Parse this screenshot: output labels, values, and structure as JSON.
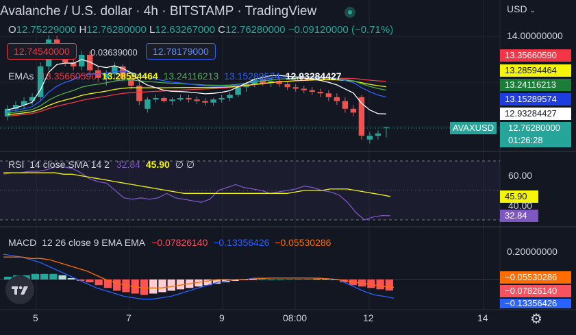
{
  "header": {
    "title": "Avalanche / U.S. dollar · 4h · BITSTAMP · TradingView",
    "currency": "USD",
    "ohlc": {
      "o_label": "O",
      "o": "12.75229000",
      "h_label": "H",
      "h": "12.76280000",
      "l_label": "L",
      "l": "12.63267000",
      "c_label": "C",
      "c": "12.76280000",
      "change": "−0.09120000 (−0.71%)"
    },
    "sell_price": "12.74540000",
    "spread": "0.03639000",
    "buy_price": "12.78179000"
  },
  "emas": {
    "label": "EMAs",
    "values": [
      "13.35660590",
      "13.28594464",
      "13.24116213",
      "13.15289574",
      "12.93284427"
    ],
    "colors": [
      "#f23645",
      "#f5f50a",
      "#4caf50",
      "#2962ff",
      "#ffffff"
    ]
  },
  "price_axis": {
    "ticks": [
      "14.00000000"
    ],
    "labels": [
      {
        "text": "13.35660590",
        "bg": "#f23645",
        "fg": "#ffffff"
      },
      {
        "text": "13.28594464",
        "bg": "#f5f50a",
        "fg": "#131722"
      },
      {
        "text": "13.24116213",
        "bg": "#1b7d37",
        "fg": "#ffffff"
      },
      {
        "text": "13.15289574",
        "bg": "#1e3de0",
        "fg": "#ffffff"
      },
      {
        "text": "12.93284427",
        "bg": "#ffffff",
        "fg": "#131722"
      }
    ],
    "symbol": "AVAXUSD",
    "last_price": "12.76280000",
    "countdown": "01:26:28"
  },
  "rsi": {
    "label": "RSI",
    "params": "14 close SMA 14 2",
    "value": "32.84",
    "sma": "45.90",
    "extra": "∅ ∅",
    "ticks": [
      "60.00",
      "40.00"
    ],
    "upper": 70,
    "lower": 30
  },
  "macd": {
    "label": "MACD",
    "params": "12 26 close 9 EMA EMA",
    "histogram": "−0.07826140",
    "macd": "−0.13356426",
    "signal": "−0.05530286",
    "ticks": [
      "0.20000000"
    ],
    "axis_labels": [
      "−0.05530286",
      "−0.07826140",
      "−0.13356426"
    ]
  },
  "time_axis": [
    "5",
    "7",
    "9",
    "08:00",
    "12",
    "14"
  ],
  "colors": {
    "up": "#26a69a",
    "down": "#ef5350",
    "bg": "#131722",
    "grid": "#2a2e39",
    "text": "#d1d4dc"
  },
  "chart_data": [
    {
      "type": "candlestick",
      "title": "Avalanche / U.S. dollar · 4h · BITSTAMP",
      "x": [
        "5",
        "7",
        "9",
        "08:00",
        "12",
        "14"
      ],
      "candles": [
        {
          "o": 12.9,
          "h": 13.05,
          "l": 12.85,
          "c": 13.0
        },
        {
          "o": 13.0,
          "h": 13.1,
          "l": 12.95,
          "c": 13.05
        },
        {
          "o": 13.05,
          "h": 13.15,
          "l": 13.0,
          "c": 13.1
        },
        {
          "o": 13.1,
          "h": 13.2,
          "l": 13.05,
          "c": 13.15
        },
        {
          "o": 13.15,
          "h": 13.6,
          "l": 13.1,
          "c": 13.55
        },
        {
          "o": 13.55,
          "h": 13.95,
          "l": 13.5,
          "c": 13.9
        },
        {
          "o": 13.9,
          "h": 13.95,
          "l": 13.7,
          "c": 13.75
        },
        {
          "o": 13.75,
          "h": 13.8,
          "l": 13.55,
          "c": 13.6
        },
        {
          "o": 13.6,
          "h": 13.7,
          "l": 13.5,
          "c": 13.55
        },
        {
          "o": 13.55,
          "h": 13.75,
          "l": 13.5,
          "c": 13.7
        },
        {
          "o": 13.7,
          "h": 13.75,
          "l": 13.45,
          "c": 13.5
        },
        {
          "o": 13.5,
          "h": 13.55,
          "l": 13.35,
          "c": 13.4
        },
        {
          "o": 13.4,
          "h": 13.5,
          "l": 13.3,
          "c": 13.45
        },
        {
          "o": 13.45,
          "h": 13.6,
          "l": 13.4,
          "c": 13.55
        },
        {
          "o": 13.55,
          "h": 13.58,
          "l": 13.35,
          "c": 13.4
        },
        {
          "o": 13.4,
          "h": 13.45,
          "l": 13.25,
          "c": 13.3
        },
        {
          "o": 13.3,
          "h": 13.35,
          "l": 13.05,
          "c": 13.1
        },
        {
          "o": 13.0,
          "h": 13.15,
          "l": 12.95,
          "c": 13.12
        },
        {
          "o": 13.12,
          "h": 13.18,
          "l": 13.08,
          "c": 13.14
        },
        {
          "o": 13.14,
          "h": 13.16,
          "l": 13.08,
          "c": 13.1
        },
        {
          "o": 13.1,
          "h": 13.15,
          "l": 13.05,
          "c": 13.12
        },
        {
          "o": 13.12,
          "h": 13.18,
          "l": 13.1,
          "c": 13.14
        },
        {
          "o": 13.14,
          "h": 13.18,
          "l": 13.08,
          "c": 13.12
        },
        {
          "o": 13.12,
          "h": 13.16,
          "l": 13.06,
          "c": 13.1
        },
        {
          "o": 13.1,
          "h": 13.14,
          "l": 13.04,
          "c": 13.08
        },
        {
          "o": 13.08,
          "h": 13.14,
          "l": 13.04,
          "c": 13.12
        },
        {
          "o": 13.12,
          "h": 13.18,
          "l": 13.08,
          "c": 13.14
        },
        {
          "o": 13.14,
          "h": 13.22,
          "l": 13.1,
          "c": 13.18
        },
        {
          "o": 13.18,
          "h": 13.3,
          "l": 13.15,
          "c": 13.28
        },
        {
          "o": 13.28,
          "h": 13.35,
          "l": 13.22,
          "c": 13.32
        },
        {
          "o": 13.32,
          "h": 13.42,
          "l": 13.28,
          "c": 13.38
        },
        {
          "o": 13.38,
          "h": 13.45,
          "l": 13.3,
          "c": 13.33
        },
        {
          "o": 13.33,
          "h": 13.4,
          "l": 13.28,
          "c": 13.36
        },
        {
          "o": 13.36,
          "h": 13.4,
          "l": 13.28,
          "c": 13.32
        },
        {
          "o": 13.32,
          "h": 13.36,
          "l": 13.24,
          "c": 13.28
        },
        {
          "o": 13.28,
          "h": 13.32,
          "l": 13.22,
          "c": 13.26
        },
        {
          "o": 13.26,
          "h": 13.3,
          "l": 13.2,
          "c": 13.24
        },
        {
          "o": 13.24,
          "h": 13.28,
          "l": 13.18,
          "c": 13.22
        },
        {
          "o": 13.22,
          "h": 13.26,
          "l": 13.15,
          "c": 13.2
        },
        {
          "o": 13.2,
          "h": 13.24,
          "l": 13.1,
          "c": 13.15
        },
        {
          "o": 13.15,
          "h": 13.2,
          "l": 13.05,
          "c": 13.1
        },
        {
          "o": 13.1,
          "h": 13.15,
          "l": 12.95,
          "c": 13.0
        },
        {
          "o": 13.0,
          "h": 13.05,
          "l": 12.9,
          "c": 12.95
        },
        {
          "o": 13.15,
          "h": 13.18,
          "l": 12.6,
          "c": 12.65
        },
        {
          "o": 12.6,
          "h": 12.7,
          "l": 12.55,
          "c": 12.65
        },
        {
          "o": 12.65,
          "h": 12.72,
          "l": 12.6,
          "c": 12.68
        },
        {
          "o": 12.75,
          "h": 12.76,
          "l": 12.63,
          "c": 12.76
        }
      ],
      "ema_series": [
        {
          "value": 13.3566059,
          "color": "#f23645"
        },
        {
          "value": 13.28594464,
          "color": "#f5f50a"
        },
        {
          "value": 13.24116213,
          "color": "#4caf50"
        },
        {
          "value": 13.15289574,
          "color": "#2962ff"
        },
        {
          "value": 12.93284427,
          "color": "#ffffff"
        }
      ]
    },
    {
      "type": "line",
      "title": "RSI 14 close SMA 14 2",
      "ylim": [
        20,
        80
      ],
      "series": [
        {
          "name": "RSI",
          "values": [
            61,
            62,
            62,
            63,
            63,
            64,
            66,
            66,
            65,
            62,
            58,
            56,
            55,
            50,
            45,
            44,
            45,
            44,
            45,
            48,
            45,
            44,
            43,
            42,
            44,
            50,
            52,
            54,
            52,
            51,
            50,
            48,
            49,
            50,
            51,
            53,
            52,
            50,
            49,
            47,
            42,
            35,
            30,
            32,
            33,
            32.84
          ]
        },
        {
          "name": "SMA",
          "values": [
            62,
            62,
            62,
            62,
            62,
            62,
            62,
            61,
            61,
            60,
            59,
            58,
            57,
            56,
            55,
            54,
            53,
            52,
            51,
            50,
            49,
            48,
            48,
            48,
            48,
            48,
            48,
            48,
            48,
            48,
            48,
            48,
            48,
            48,
            49,
            50,
            50,
            50,
            51,
            51,
            51,
            50,
            49,
            48,
            47,
            45.9
          ]
        }
      ]
    },
    {
      "type": "bar",
      "title": "MACD 12 26 close 9 EMA EMA",
      "histogram": [
        0.02,
        0.03,
        0.03,
        0.04,
        0.04,
        0.04,
        0.03,
        0.01,
        -0.01,
        -0.02,
        -0.04,
        -0.06,
        -0.08,
        -0.09,
        -0.1,
        -0.11,
        -0.1,
        -0.09,
        -0.08,
        -0.07,
        -0.06,
        -0.05,
        -0.04,
        -0.03,
        -0.02,
        -0.01,
        -0.005,
        -0.002,
        0.0,
        0.0,
        0.0,
        0.002,
        0.004,
        0.005,
        0.004,
        0.003,
        0.001,
        -0.02,
        -0.04,
        -0.05,
        -0.06,
        -0.07,
        -0.0782614
      ],
      "series": [
        {
          "name": "MACD",
          "values": [
            0.18,
            0.17,
            0.16,
            0.14,
            0.12,
            0.09,
            0.06,
            0.03,
            0.0,
            -0.03,
            -0.06,
            -0.08,
            -0.1,
            -0.12,
            -0.13,
            -0.14,
            -0.14,
            -0.13,
            -0.12,
            -0.1,
            -0.08,
            -0.06,
            -0.04,
            -0.02,
            -0.01,
            0.0,
            0.0,
            0.01,
            0.01,
            0.01,
            0.01,
            0.01,
            0.01,
            0.01,
            0.01,
            0.005,
            0.0,
            -0.03,
            -0.06,
            -0.09,
            -0.11,
            -0.12,
            -0.13356426
          ]
        },
        {
          "name": "Signal",
          "values": [
            0.16,
            0.16,
            0.16,
            0.15,
            0.15,
            0.14,
            0.12,
            0.1,
            0.08,
            0.06,
            0.03,
            0.0,
            -0.02,
            -0.04,
            -0.05,
            -0.06,
            -0.06,
            -0.06,
            -0.05,
            -0.04,
            -0.03,
            -0.02,
            -0.01,
            0.0,
            0.0,
            0.0,
            0.0,
            0.005,
            0.008,
            0.01,
            0.01,
            0.01,
            0.01,
            0.01,
            0.008,
            0.005,
            0.0,
            -0.01,
            -0.02,
            -0.03,
            -0.04,
            -0.05,
            -0.05530286
          ]
        }
      ]
    }
  ]
}
